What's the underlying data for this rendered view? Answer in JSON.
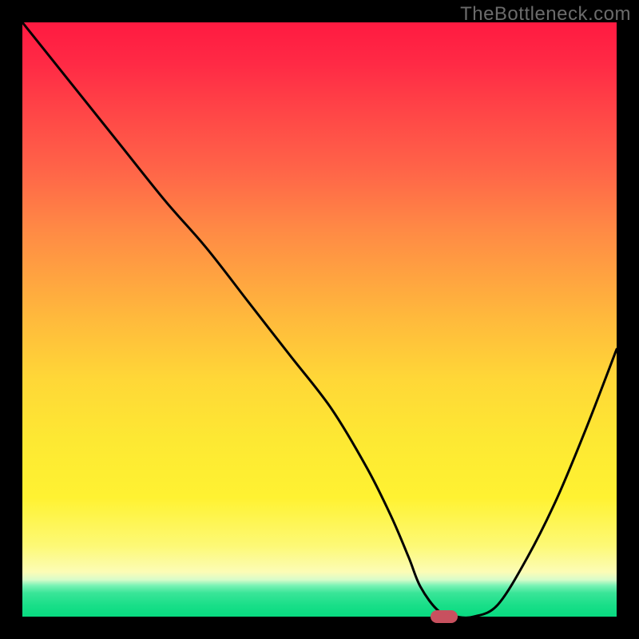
{
  "watermark": "TheBottleneck.com",
  "chart_data": {
    "type": "line",
    "title": "",
    "xlabel": "",
    "ylabel": "",
    "xlim": [
      0,
      100
    ],
    "ylim": [
      0,
      100
    ],
    "x": [
      0,
      8,
      16,
      24,
      31,
      38,
      45,
      52,
      58,
      62,
      65,
      67,
      70,
      73,
      76,
      80,
      85,
      90,
      95,
      100
    ],
    "values": [
      100,
      90,
      80,
      70,
      62,
      53,
      44,
      35,
      25,
      17,
      10,
      5,
      1,
      0,
      0,
      2,
      10,
      20,
      32,
      45
    ],
    "marker": {
      "x": 71,
      "y": 0
    },
    "background_gradient": {
      "top": "#ff1a41",
      "mid": "#ffd737",
      "bottom": "#08da80"
    }
  }
}
